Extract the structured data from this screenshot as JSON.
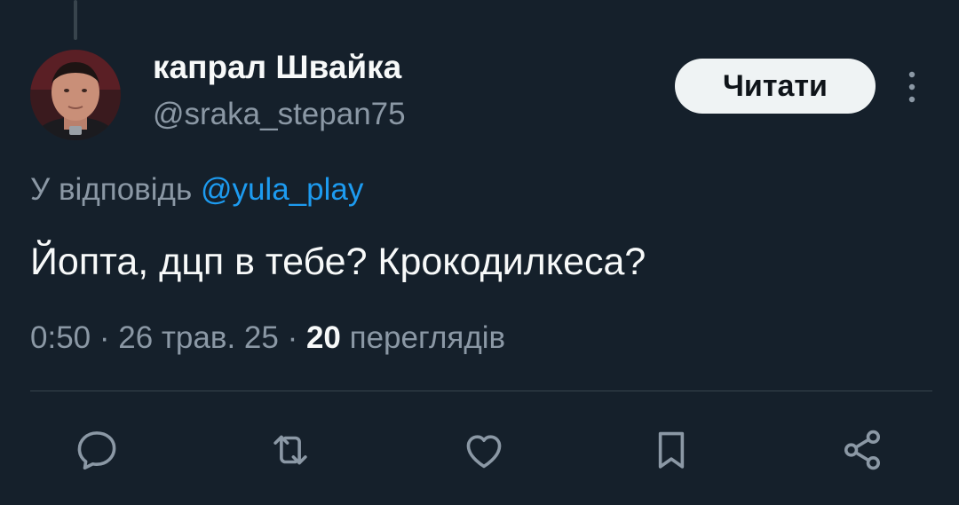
{
  "author": {
    "display_name": "капрал Швайка",
    "handle": "@sraka_stepan75"
  },
  "follow_button": {
    "label": "Читати"
  },
  "more_button": {
    "icon": "more-vertical-icon"
  },
  "reply_to": {
    "prefix": "У відповідь",
    "mention": "@yula_play"
  },
  "tweet": {
    "text": "Йопта, дцп в тебе? Крокодилкеса?"
  },
  "meta": {
    "time": "0:50",
    "separator": "·",
    "date": "26 трав. 25",
    "views_count": "20",
    "views_label": "переглядів"
  },
  "actions": [
    {
      "icon": "reply-icon"
    },
    {
      "icon": "retweet-icon"
    },
    {
      "icon": "like-icon"
    },
    {
      "icon": "bookmark-icon"
    },
    {
      "icon": "share-icon"
    }
  ],
  "colors": {
    "background": "#15202b",
    "text_primary": "#f7f9f9",
    "text_secondary": "#8b98a5",
    "accent": "#1d9bf0",
    "divider": "#38444d",
    "button_bg": "#eff3f4",
    "button_text": "#0f1419"
  }
}
